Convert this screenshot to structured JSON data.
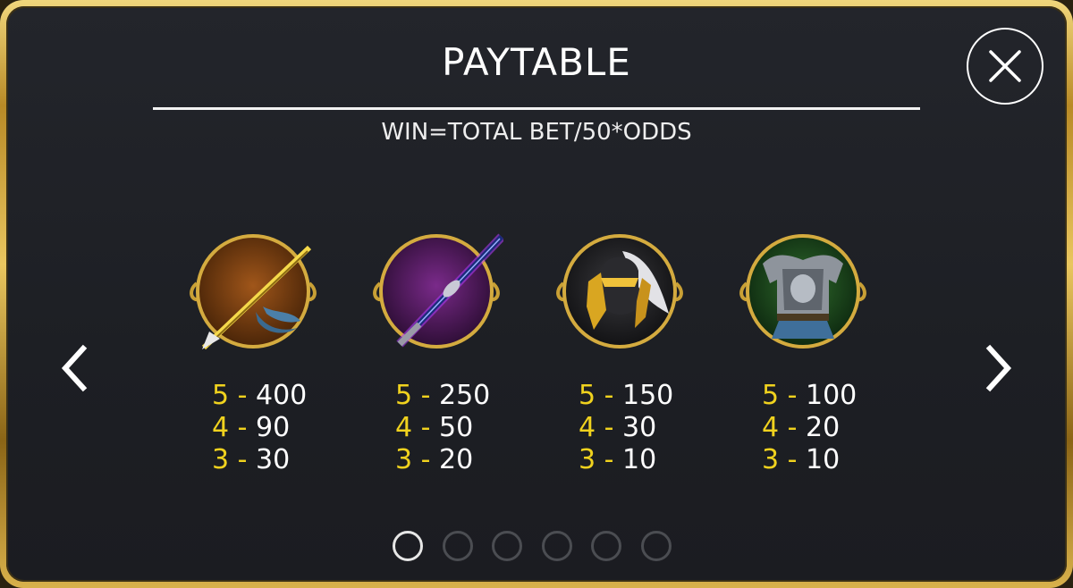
{
  "header": {
    "title": "PAYTABLE",
    "subtitle": "WIN=TOTAL BET/50*ODDS"
  },
  "close_icon": "close-icon",
  "nav": {
    "prev_icon": "chevron-left-icon",
    "next_icon": "chevron-right-icon"
  },
  "symbols": [
    {
      "icon": "golden-spear-icon",
      "payouts": [
        {
          "count": "5 -",
          "value": "400"
        },
        {
          "count": "4 -",
          "value": "90"
        },
        {
          "count": "3 -",
          "value": "30"
        }
      ]
    },
    {
      "icon": "purple-sword-icon",
      "payouts": [
        {
          "count": "5 -",
          "value": "250"
        },
        {
          "count": "4 -",
          "value": "50"
        },
        {
          "count": "3 -",
          "value": "20"
        }
      ]
    },
    {
      "icon": "knight-helmet-icon",
      "payouts": [
        {
          "count": "5 -",
          "value": "150"
        },
        {
          "count": "4 -",
          "value": "30"
        },
        {
          "count": "3 -",
          "value": "10"
        }
      ]
    },
    {
      "icon": "armor-icon",
      "payouts": [
        {
          "count": "5 -",
          "value": "100"
        },
        {
          "count": "4 -",
          "value": "20"
        },
        {
          "count": "3 -",
          "value": "10"
        }
      ]
    }
  ],
  "pagination": {
    "total_pages": 6,
    "current_page": 1
  },
  "colors": {
    "frame_gold": "#c9a035",
    "payout_count": "#f0d21e",
    "panel_bg": "#1f2126"
  }
}
